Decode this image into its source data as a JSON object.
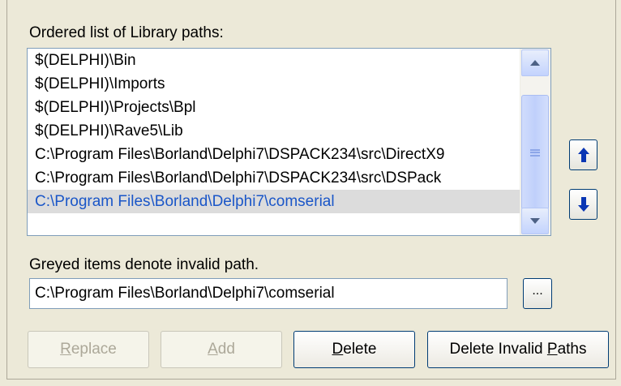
{
  "labels": {
    "ordered_list": "Ordered list of Library paths:",
    "greyed_note": "Greyed items denote invalid path."
  },
  "library_paths": [
    "$(DELPHI)\\Bin",
    "$(DELPHI)\\Imports",
    "$(DELPHI)\\Projects\\Bpl",
    "$(DELPHI)\\Rave5\\Lib",
    "C:\\Program Files\\Borland\\Delphi7\\DSPACK234\\src\\DirectX9",
    "C:\\Program Files\\Borland\\Delphi7\\DSPACK234\\src\\DSPack",
    "C:\\Program Files\\Borland\\Delphi7\\comserial"
  ],
  "selected_index": 6,
  "path_input": {
    "value": "C:\\Program Files\\Borland\\Delphi7\\comserial"
  },
  "browse_label": "...",
  "buttons": {
    "replace": {
      "accel": "R",
      "rest": "eplace",
      "enabled": false
    },
    "add": {
      "accel": "A",
      "rest": "dd",
      "enabled": false
    },
    "delete": {
      "accel": "D",
      "rest": "elete",
      "enabled": true
    },
    "delete_invalid": {
      "pre": "Delete Invalid ",
      "accel": "P",
      "rest": "aths",
      "enabled": true
    }
  },
  "icons": {
    "move_up": "arrow-up-icon",
    "move_down": "arrow-down-icon",
    "scroll_up": "triangle-up-icon",
    "scroll_down": "triangle-down-icon"
  },
  "colors": {
    "dialog_bg": "#ece9d8",
    "selected_text": "#1a56c8",
    "selected_bg": "#dcdcdc",
    "arrow_blue": "#0a36b4",
    "disabled_text": "#aca899"
  }
}
